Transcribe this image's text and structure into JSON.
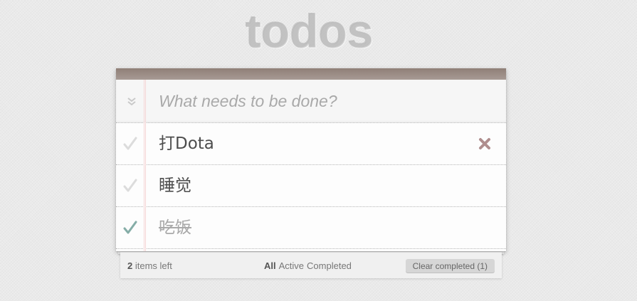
{
  "app": {
    "title": "todos"
  },
  "new_todo": {
    "placeholder": "What needs to be done?",
    "value": ""
  },
  "todos": [
    {
      "title": "打Dota",
      "completed": false
    },
    {
      "title": "睡觉",
      "completed": false
    },
    {
      "title": "吃饭",
      "completed": true
    }
  ],
  "footer": {
    "count": "2",
    "count_suffix": " items left",
    "filters": [
      "All",
      "Active",
      "Completed"
    ],
    "selected_filter": "All",
    "clear_completed_label": "Clear completed (1)"
  },
  "colors": {
    "header_bar": "#8f7f77",
    "check_done": "#85ada7",
    "check_undone": "#dcdcdc",
    "destroy": "#af8d8d"
  },
  "icons": {
    "toggle_all": "double-chevron-down-icon",
    "check": "checkmark-icon",
    "destroy": "x-icon"
  }
}
